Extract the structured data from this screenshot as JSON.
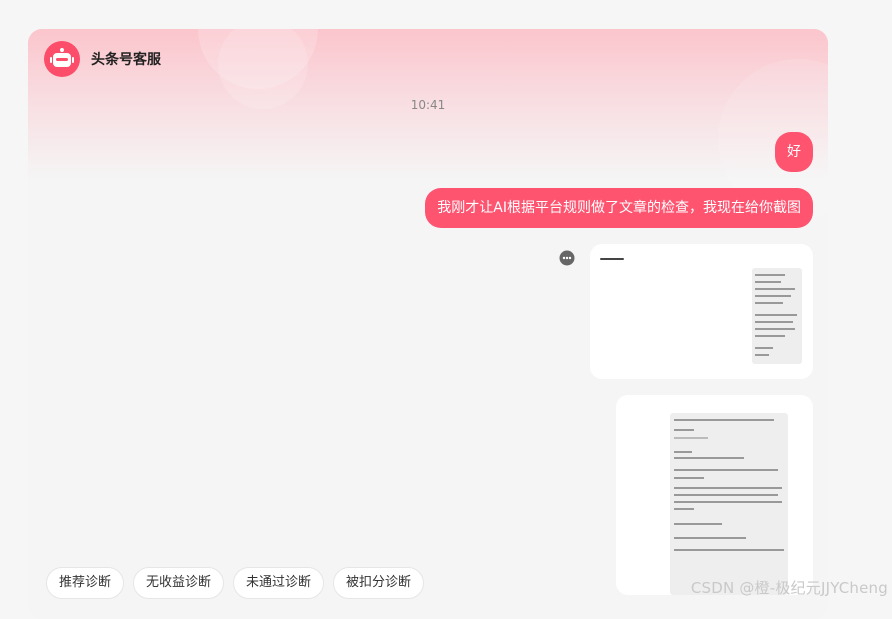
{
  "header": {
    "title": "头条号客服",
    "avatar_icon": "robot-icon"
  },
  "timestamp": "10:41",
  "messages": [
    {
      "text": "好"
    },
    {
      "text": "我刚才让AI根据平台规则做了文章的检查，我现在给你截图"
    }
  ],
  "quick_replies": [
    "推荐诊断",
    "无收益诊断",
    "未通过诊断",
    "被扣分诊断"
  ],
  "watermark": "CSDN @橙-极纪元JJYCheng",
  "colors": {
    "accent": "#fe5470",
    "avatar_bg": "#fc4d6a"
  }
}
